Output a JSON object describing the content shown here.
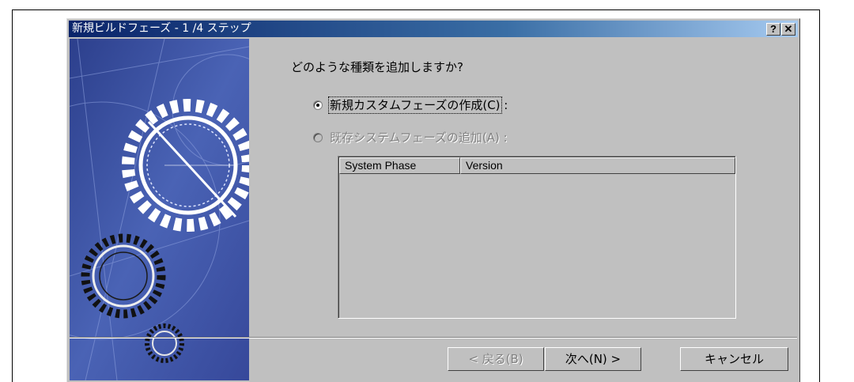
{
  "window": {
    "title": "新規ビルドフェーズ - 1 /4 ステップ",
    "help_label": "?",
    "close_label": "✕"
  },
  "content": {
    "question": "どのような種類を追加しますか?",
    "options": [
      {
        "label": "新規カスタムフェーズの作成(C)",
        "suffix": " :",
        "selected": true,
        "enabled": true
      },
      {
        "label": "既存システムフェーズの追加(A) :",
        "selected": false,
        "enabled": false
      }
    ],
    "list": {
      "columns": [
        "System Phase",
        "Version"
      ],
      "rows": []
    }
  },
  "buttons": {
    "back": "< 戻る(B)",
    "next": "次へ(N) >",
    "cancel": "キャンセル"
  },
  "colors": {
    "dialog_face": "#c0c0c0",
    "titlebar_start": "#0a246a",
    "titlebar_end": "#a6caf0",
    "art_background": "#3e55a6"
  }
}
